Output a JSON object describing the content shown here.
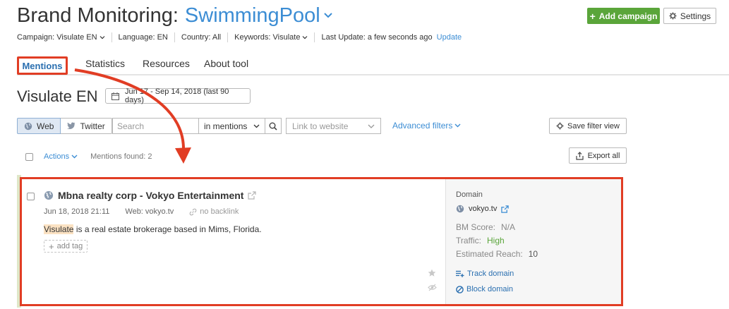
{
  "header": {
    "title": "Brand Monitoring:",
    "project": "SwimmingPool",
    "add_campaign_label": "Add campaign",
    "settings_label": "Settings"
  },
  "meta": {
    "campaign": "Campaign: Visulate EN",
    "language": "Language: EN",
    "country": "Country: All",
    "keywords": "Keywords: Visulate",
    "last_update": "Last Update: a few seconds ago",
    "update_link": "Update"
  },
  "tabs": [
    "Mentions",
    "Statistics",
    "Resources",
    "About tool"
  ],
  "page": {
    "heading": "Visulate EN",
    "date_range": "Jun 17 - Sep 14, 2018 (last 90 days)"
  },
  "filters": {
    "web_label": "Web",
    "twitter_label": "Twitter",
    "search_placeholder": "Search",
    "scope": "in mentions",
    "link_placeholder": "Link to website",
    "advanced_label": "Advanced filters",
    "save_view_label": "Save filter view"
  },
  "list": {
    "actions_label": "Actions",
    "found_label": "Mentions found: 2",
    "export_label": "Export all"
  },
  "mention": {
    "title": "Mbna realty corp - Vokyo Entertainment",
    "datetime": "Jun 18, 2018 21:11",
    "web": "Web: vokyo.tv",
    "backlink": "no backlink",
    "snippet_highlight": "Visulate",
    "snippet_rest": " is a real estate brokerage based in Mims, Florida.",
    "add_tag": "add tag"
  },
  "domain_panel": {
    "domain_label": "Domain",
    "domain": "vokyo.tv",
    "bm_score_label": "BM Score:",
    "bm_score_value": "N/A",
    "traffic_label": "Traffic:",
    "traffic_value": "High",
    "reach_label": "Estimated Reach:",
    "reach_value": "10",
    "track_label": "Track domain",
    "block_label": "Block domain"
  },
  "colors": {
    "accent_blue": "#3c8dd4",
    "brand_green": "#5aa53a",
    "highlight_red": "#e13d24"
  }
}
